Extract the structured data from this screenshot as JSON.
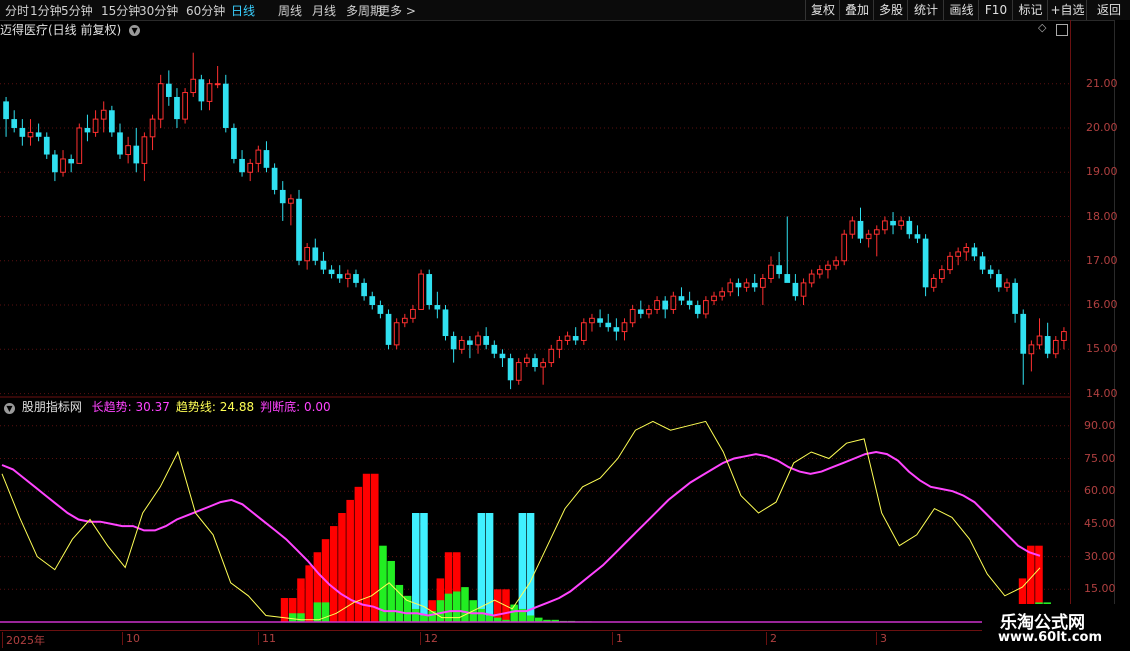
{
  "toolbar": {
    "left": [
      {
        "label": "分时",
        "active": false
      },
      {
        "label": "1分钟",
        "active": false
      },
      {
        "label": "5分钟",
        "active": false
      },
      {
        "label": "15分钟",
        "active": false
      },
      {
        "label": "30分钟",
        "active": false
      },
      {
        "label": "60分钟",
        "active": false
      },
      {
        "label": "日线",
        "active": true
      },
      {
        "label": "周线",
        "active": false
      },
      {
        "label": "月线",
        "active": false
      },
      {
        "label": "多周期",
        "active": false
      },
      {
        "label": "更多 >",
        "active": false
      }
    ],
    "right": [
      "复权",
      "叠加",
      "多股",
      "统计",
      "画线",
      "F10",
      "标记",
      "+自选",
      "返回"
    ]
  },
  "chart_title": "迈得医疗(日线 前复权)",
  "price_axis": [
    "21.00",
    "20.00",
    "19.00",
    "18.00",
    "17.00",
    "16.00",
    "15.00",
    "14.00"
  ],
  "indicator": {
    "name": "股朋指标网",
    "items": [
      {
        "label": "长趋势: 30.37",
        "color": "#ff44ff"
      },
      {
        "label": "趋势线: 24.88",
        "color": "#ffff55"
      },
      {
        "label": "判断底: 0.00",
        "color": "#ff44ff"
      }
    ],
    "axis": [
      "90.00",
      "75.00",
      "60.00",
      "45.00",
      "30.00",
      "15.00"
    ]
  },
  "date_axis": [
    "2025年",
    "10",
    "11",
    "12",
    "1",
    "2",
    "3"
  ],
  "watermark": {
    "line1": "乐淘公式网",
    "line2": "www.60lt.com"
  },
  "colors": {
    "up": "#ff3030",
    "down": "#30e0f0",
    "long_trend": "#ff44ff",
    "trend_line": "#ffff55",
    "green_bar": "#22ee22",
    "grid": "#5a1010"
  },
  "chart_data": {
    "type": "candlestick",
    "ohlc": [
      [
        20.6,
        20.7,
        19.8,
        20.2
      ],
      [
        20.2,
        20.4,
        19.9,
        20.0
      ],
      [
        20.0,
        20.2,
        19.6,
        19.8
      ],
      [
        19.8,
        20.2,
        19.6,
        19.9
      ],
      [
        19.9,
        20.1,
        19.7,
        19.8
      ],
      [
        19.8,
        19.9,
        19.3,
        19.4
      ],
      [
        19.4,
        19.5,
        18.8,
        19.0
      ],
      [
        19.0,
        19.5,
        18.9,
        19.3
      ],
      [
        19.3,
        19.4,
        19.0,
        19.2
      ],
      [
        19.2,
        20.1,
        19.2,
        20.0
      ],
      [
        20.0,
        20.3,
        19.7,
        19.9
      ],
      [
        19.9,
        20.4,
        19.8,
        20.2
      ],
      [
        20.2,
        20.6,
        19.9,
        20.4
      ],
      [
        20.4,
        20.5,
        19.8,
        19.9
      ],
      [
        19.9,
        20.1,
        19.3,
        19.4
      ],
      [
        19.4,
        19.8,
        19.2,
        19.6
      ],
      [
        19.6,
        20.0,
        19.0,
        19.2
      ],
      [
        19.2,
        19.9,
        18.8,
        19.8
      ],
      [
        19.8,
        20.3,
        19.5,
        20.2
      ],
      [
        20.2,
        21.2,
        20.0,
        21.0
      ],
      [
        21.0,
        21.3,
        20.5,
        20.7
      ],
      [
        20.7,
        20.9,
        20.0,
        20.2
      ],
      [
        20.2,
        20.9,
        20.1,
        20.8
      ],
      [
        20.8,
        21.7,
        20.7,
        21.1
      ],
      [
        21.1,
        21.2,
        20.4,
        20.6
      ],
      [
        20.6,
        21.1,
        20.4,
        21.0
      ],
      [
        21.0,
        21.4,
        20.9,
        21.0
      ],
      [
        21.0,
        21.2,
        19.9,
        20.0
      ],
      [
        20.0,
        20.1,
        19.2,
        19.3
      ],
      [
        19.3,
        19.5,
        18.9,
        19.0
      ],
      [
        19.0,
        19.3,
        18.8,
        19.2
      ],
      [
        19.2,
        19.6,
        19.0,
        19.5
      ],
      [
        19.5,
        19.7,
        19.0,
        19.1
      ],
      [
        19.1,
        19.2,
        18.5,
        18.6
      ],
      [
        18.6,
        18.8,
        17.9,
        18.3
      ],
      [
        18.3,
        18.5,
        17.8,
        18.4
      ],
      [
        18.4,
        18.6,
        16.9,
        17.0
      ],
      [
        17.0,
        17.4,
        16.8,
        17.3
      ],
      [
        17.3,
        17.5,
        16.9,
        17.0
      ],
      [
        17.0,
        17.2,
        16.7,
        16.8
      ],
      [
        16.8,
        16.9,
        16.6,
        16.7
      ],
      [
        16.7,
        16.9,
        16.5,
        16.6
      ],
      [
        16.6,
        16.8,
        16.4,
        16.7
      ],
      [
        16.7,
        16.8,
        16.4,
        16.5
      ],
      [
        16.5,
        16.6,
        16.1,
        16.2
      ],
      [
        16.2,
        16.3,
        15.9,
        16.0
      ],
      [
        16.0,
        16.1,
        15.7,
        15.8
      ],
      [
        15.8,
        15.9,
        15.0,
        15.1
      ],
      [
        15.1,
        15.7,
        15.0,
        15.6
      ],
      [
        15.6,
        15.8,
        15.5,
        15.7
      ],
      [
        15.7,
        16.0,
        15.6,
        15.9
      ],
      [
        15.9,
        16.8,
        15.9,
        16.7
      ],
      [
        16.7,
        16.8,
        15.9,
        16.0
      ],
      [
        16.0,
        16.3,
        15.7,
        15.9
      ],
      [
        15.9,
        16.0,
        15.2,
        15.3
      ],
      [
        15.3,
        15.4,
        14.7,
        15.0
      ],
      [
        15.0,
        15.3,
        14.9,
        15.2
      ],
      [
        15.2,
        15.3,
        14.8,
        15.1
      ],
      [
        15.1,
        15.4,
        14.9,
        15.3
      ],
      [
        15.3,
        15.5,
        15.0,
        15.1
      ],
      [
        15.1,
        15.2,
        14.8,
        14.9
      ],
      [
        14.9,
        15.0,
        14.6,
        14.8
      ],
      [
        14.8,
        14.9,
        14.1,
        14.3
      ],
      [
        14.3,
        14.8,
        14.2,
        14.7
      ],
      [
        14.7,
        14.9,
        14.6,
        14.8
      ],
      [
        14.8,
        14.9,
        14.5,
        14.6
      ],
      [
        14.6,
        14.8,
        14.2,
        14.7
      ],
      [
        14.7,
        15.1,
        14.6,
        15.0
      ],
      [
        15.0,
        15.3,
        14.8,
        15.2
      ],
      [
        15.2,
        15.4,
        15.1,
        15.3
      ],
      [
        15.3,
        15.5,
        15.1,
        15.2
      ],
      [
        15.2,
        15.7,
        15.1,
        15.6
      ],
      [
        15.6,
        15.8,
        15.4,
        15.7
      ],
      [
        15.7,
        15.9,
        15.5,
        15.6
      ],
      [
        15.6,
        15.8,
        15.4,
        15.5
      ],
      [
        15.5,
        15.7,
        15.2,
        15.4
      ],
      [
        15.4,
        15.7,
        15.2,
        15.6
      ],
      [
        15.6,
        16.0,
        15.5,
        15.9
      ],
      [
        15.9,
        16.1,
        15.7,
        15.8
      ],
      [
        15.8,
        16.0,
        15.7,
        15.9
      ],
      [
        15.9,
        16.2,
        15.8,
        16.1
      ],
      [
        16.1,
        16.2,
        15.7,
        15.9
      ],
      [
        15.9,
        16.3,
        15.8,
        16.2
      ],
      [
        16.2,
        16.4,
        16.0,
        16.1
      ],
      [
        16.1,
        16.3,
        15.9,
        16.0
      ],
      [
        16.0,
        16.1,
        15.7,
        15.8
      ],
      [
        15.8,
        16.2,
        15.7,
        16.1
      ],
      [
        16.1,
        16.3,
        16.0,
        16.2
      ],
      [
        16.2,
        16.4,
        16.1,
        16.3
      ],
      [
        16.3,
        16.6,
        16.2,
        16.5
      ],
      [
        16.5,
        16.6,
        16.2,
        16.4
      ],
      [
        16.4,
        16.6,
        16.3,
        16.5
      ],
      [
        16.5,
        16.7,
        16.3,
        16.4
      ],
      [
        16.4,
        16.7,
        16.0,
        16.6
      ],
      [
        16.6,
        17.1,
        16.5,
        16.9
      ],
      [
        16.9,
        17.2,
        16.6,
        16.7
      ],
      [
        16.7,
        18.0,
        16.6,
        16.5
      ],
      [
        16.5,
        16.7,
        16.1,
        16.2
      ],
      [
        16.2,
        16.6,
        16.0,
        16.5
      ],
      [
        16.5,
        16.8,
        16.4,
        16.7
      ],
      [
        16.7,
        16.9,
        16.6,
        16.8
      ],
      [
        16.8,
        17.0,
        16.6,
        16.9
      ],
      [
        16.9,
        17.1,
        16.8,
        17.0
      ],
      [
        17.0,
        17.7,
        16.9,
        17.6
      ],
      [
        17.6,
        18.0,
        17.5,
        17.9
      ],
      [
        17.9,
        18.2,
        17.4,
        17.5
      ],
      [
        17.5,
        17.7,
        17.3,
        17.6
      ],
      [
        17.6,
        17.8,
        17.1,
        17.7
      ],
      [
        17.7,
        18.0,
        17.6,
        17.9
      ],
      [
        17.9,
        18.1,
        17.6,
        17.8
      ],
      [
        17.8,
        18.0,
        17.7,
        17.9
      ],
      [
        17.9,
        18.0,
        17.5,
        17.6
      ],
      [
        17.6,
        17.8,
        17.4,
        17.5
      ],
      [
        17.5,
        17.6,
        16.2,
        16.4
      ],
      [
        16.4,
        16.7,
        16.3,
        16.6
      ],
      [
        16.6,
        16.9,
        16.5,
        16.8
      ],
      [
        16.8,
        17.2,
        16.7,
        17.1
      ],
      [
        17.1,
        17.3,
        16.9,
        17.2
      ],
      [
        17.2,
        17.4,
        17.0,
        17.3
      ],
      [
        17.3,
        17.4,
        17.0,
        17.1
      ],
      [
        17.1,
        17.2,
        16.7,
        16.8
      ],
      [
        16.8,
        16.9,
        16.6,
        16.7
      ],
      [
        16.7,
        16.8,
        16.3,
        16.4
      ],
      [
        16.4,
        16.6,
        16.3,
        16.5
      ],
      [
        16.5,
        16.6,
        15.6,
        15.8
      ],
      [
        15.8,
        15.9,
        14.2,
        14.9
      ],
      [
        14.9,
        15.2,
        14.5,
        15.1
      ],
      [
        15.1,
        15.7,
        15.0,
        15.3
      ],
      [
        15.3,
        15.6,
        14.8,
        14.9
      ],
      [
        14.9,
        15.3,
        14.8,
        15.2
      ],
      [
        15.2,
        15.5,
        15.0,
        15.4
      ]
    ],
    "price_ylim": [
      13.9,
      22.1
    ],
    "indicator_ylim": [
      0,
      100
    ],
    "long_trend": [
      72,
      70,
      66,
      62,
      58,
      54,
      50,
      47,
      46,
      46,
      45,
      44,
      44,
      42,
      42,
      44,
      47,
      49,
      51,
      53,
      55,
      56,
      54,
      50,
      46,
      42,
      38,
      33,
      28,
      22,
      17,
      13,
      10,
      8,
      7,
      5,
      5,
      4,
      4,
      3,
      4,
      5,
      5,
      4,
      4,
      3,
      4,
      5,
      5,
      7,
      9,
      11,
      14,
      18,
      22,
      26,
      31,
      36,
      41,
      46,
      51,
      56,
      60,
      64,
      67,
      70,
      73,
      75,
      76,
      77,
      76,
      74,
      71,
      69,
      68,
      69,
      71,
      73,
      75,
      77,
      78,
      77,
      74,
      69,
      65,
      62,
      61,
      60,
      58,
      55,
      50,
      45,
      40,
      35,
      32,
      30.37
    ],
    "trend_line": [
      68,
      48,
      30,
      24,
      38,
      47,
      35,
      25,
      50,
      62,
      78,
      50,
      40,
      18,
      12,
      3,
      2,
      1,
      1,
      4,
      9,
      12,
      18,
      10,
      7,
      2,
      2,
      6,
      10,
      6,
      18,
      35,
      52,
      62,
      66,
      75,
      88,
      92,
      88,
      90,
      92,
      78,
      58,
      50,
      55,
      73,
      78,
      75,
      82,
      84,
      50,
      35,
      40,
      52,
      48,
      38,
      22,
      12,
      16,
      24.88
    ],
    "red_bars": [
      0,
      0,
      0,
      0,
      0,
      0,
      0,
      0,
      0,
      0,
      0,
      0,
      0,
      0,
      0,
      0,
      0,
      0,
      0,
      0,
      0,
      0,
      0,
      0,
      0,
      0,
      0,
      0,
      0,
      0,
      0,
      0,
      0,
      0,
      11,
      11,
      20,
      26,
      32,
      38,
      44,
      50,
      56,
      62,
      68,
      68,
      0,
      0,
      0,
      0,
      0,
      0,
      10,
      20,
      32,
      32,
      0,
      0,
      0,
      0,
      15,
      15,
      0,
      0,
      0,
      0,
      0,
      0,
      0,
      0,
      0,
      0,
      0,
      0,
      0,
      0,
      0,
      0,
      0,
      0,
      0,
      0,
      0,
      0,
      0,
      0,
      0,
      0,
      0,
      0,
      0,
      0,
      0,
      0,
      0,
      0,
      0,
      0,
      0,
      0,
      0,
      0,
      0,
      0,
      0,
      0,
      0,
      0,
      0,
      0,
      0,
      0,
      0,
      0,
      0,
      0,
      0,
      0,
      0,
      0,
      0,
      0,
      0,
      0,
      20,
      35,
      35,
      0,
      0,
      0
    ],
    "cyan_bars": [
      0,
      0,
      0,
      0,
      0,
      0,
      0,
      0,
      0,
      0,
      0,
      0,
      0,
      0,
      0,
      0,
      0,
      0,
      0,
      0,
      0,
      0,
      0,
      0,
      0,
      0,
      0,
      0,
      0,
      0,
      0,
      0,
      0,
      0,
      0,
      0,
      0,
      0,
      0,
      0,
      0,
      0,
      0,
      0,
      0,
      0,
      0,
      0,
      0,
      0,
      50,
      50,
      0,
      0,
      0,
      0,
      0,
      0,
      50,
      50,
      0,
      0,
      0,
      50,
      50,
      0,
      0,
      0,
      0,
      0,
      0,
      0,
      0,
      0,
      0,
      0,
      0,
      0,
      0,
      0,
      0,
      0,
      0,
      0,
      0,
      0,
      0,
      0,
      0,
      0,
      0,
      0,
      0,
      0,
      0,
      0,
      0,
      0,
      0,
      0,
      0,
      0,
      0,
      0,
      0,
      0,
      0,
      0,
      0,
      0,
      0,
      0,
      0,
      0,
      0,
      0,
      0,
      0,
      0,
      0,
      0,
      0,
      0,
      0,
      0,
      0,
      0,
      0,
      0,
      0,
      0,
      0,
      0
    ],
    "green_bars": [
      0,
      0,
      0,
      0,
      0,
      0,
      0,
      0,
      0,
      0,
      0,
      0,
      0,
      0,
      0,
      0,
      0,
      0,
      0,
      0,
      0,
      0,
      0,
      0,
      0,
      0,
      0,
      0,
      0,
      0,
      0,
      0,
      0,
      0,
      0,
      4,
      4,
      0,
      9,
      9,
      0,
      0,
      0,
      0,
      0,
      0,
      35,
      28,
      17,
      12,
      6,
      3,
      5,
      10,
      13,
      14,
      16,
      10,
      6,
      3,
      2,
      1,
      8,
      6,
      3,
      2,
      1,
      1,
      0.5,
      0.5,
      0.3,
      0.3,
      0.2,
      0.2,
      0.1,
      0.1,
      0,
      0,
      0,
      0,
      0,
      0,
      0,
      0,
      0,
      0,
      0,
      0,
      0,
      0,
      0,
      0,
      0,
      0,
      0,
      0,
      0,
      0,
      0,
      0,
      0,
      0,
      0,
      0,
      0,
      0,
      0,
      0,
      0,
      0,
      0,
      0,
      0,
      0,
      0,
      0,
      0,
      0,
      0,
      0,
      0,
      0,
      0,
      0,
      0,
      0,
      9,
      9,
      0,
      0
    ]
  }
}
